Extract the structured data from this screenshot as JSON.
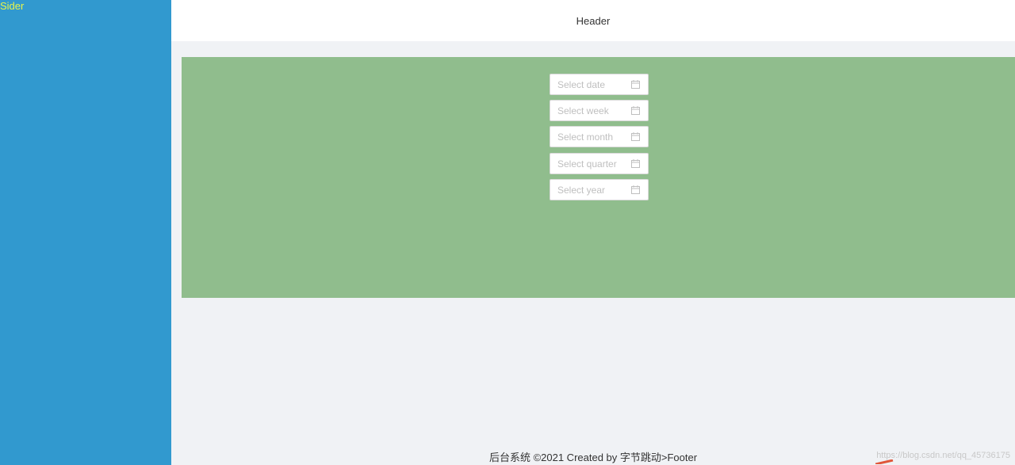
{
  "sider": {
    "title": "Sider"
  },
  "header": {
    "title": "Header"
  },
  "pickers": [
    {
      "placeholder": "Select date",
      "icon": "calendar-icon"
    },
    {
      "placeholder": "Select week",
      "icon": "calendar-icon"
    },
    {
      "placeholder": "Select month",
      "icon": "calendar-icon"
    },
    {
      "placeholder": "Select quarter",
      "icon": "calendar-icon"
    },
    {
      "placeholder": "Select year",
      "icon": "calendar-icon"
    }
  ],
  "footer": {
    "text": "后台系统 ©2021 Created by 字节跳动>Footer"
  },
  "watermark": {
    "text": "https://blog.csdn.net/qq_45736175"
  },
  "colors": {
    "sider": "#3199cf",
    "sider_title": "#e8f54a",
    "header": "#ffffff",
    "content": "#90bd8d",
    "page_bg": "#f0f2f5"
  }
}
